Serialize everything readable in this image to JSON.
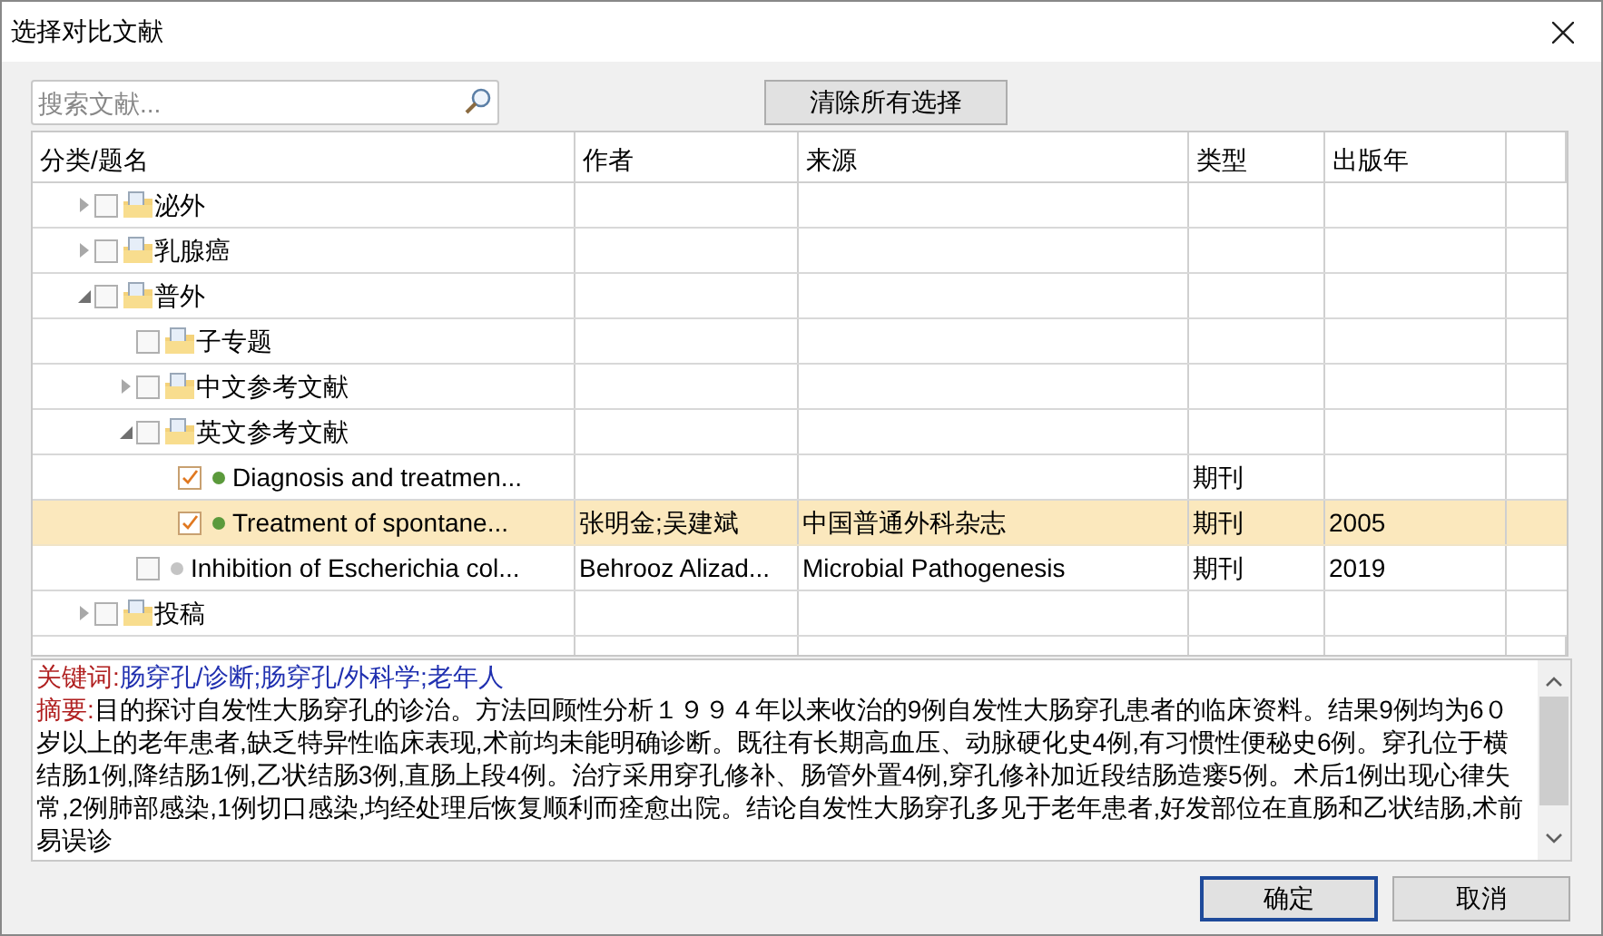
{
  "window": {
    "title": "选择对比文献"
  },
  "search": {
    "placeholder": "搜索文献..."
  },
  "clear_button": "清除所有选择",
  "table": {
    "columns": [
      "分类/题名",
      "作者",
      "来源",
      "类型",
      "出版年"
    ],
    "rows": [
      {
        "kind": "folder",
        "title": "泌外",
        "checked": false,
        "expanded": false
      },
      {
        "kind": "folder",
        "title": "乳腺癌",
        "checked": false,
        "expanded": false
      },
      {
        "kind": "folder",
        "title": "普外",
        "checked": false,
        "expanded": true,
        "children": [
          {
            "kind": "folder",
            "title": "子专题",
            "checked": false
          },
          {
            "kind": "folder",
            "title": "中文参考文献",
            "checked": false,
            "expanded": false
          },
          {
            "kind": "folder",
            "title": "英文参考文献",
            "checked": false,
            "expanded": true,
            "children": [
              {
                "kind": "document",
                "title": "Diagnosis and treatmen...",
                "checked": true,
                "selected": false,
                "color": "#5b9a3c",
                "type": "期刊"
              },
              {
                "kind": "document",
                "title": "Treatment of spontane...",
                "checked": true,
                "selected": true,
                "color": "#5b9a3c",
                "author": "张明金;吴建斌",
                "source": "中国普通外科杂志",
                "type": "期刊",
                "year": "2005"
              }
            ]
          },
          {
            "kind": "document",
            "title": "Inhibition of Escherichia col...",
            "checked": false,
            "selected": false,
            "color": "#c4c4c4",
            "author": "Behrooz Alizad...",
            "source": "Microbial Pathogenesis",
            "type": "期刊",
            "year": "2019"
          }
        ]
      },
      {
        "kind": "folder",
        "title": "投稿",
        "checked": false,
        "expanded": false
      }
    ]
  },
  "details": {
    "keywords_label": "关键词:",
    "keywords": "肠穿孔/诊断;肠穿孔/外科学;老年人",
    "abstract_label": "摘要:",
    "abstract": "目的探讨自发性大肠穿孔的诊治。方法回顾性分析１９９４年以来收治的9例自发性大肠穿孔患者的临床资料。结果9例均为6０岁以上的老年患者,缺乏特异性临床表现,术前均未能明确诊断。既往有长期高血压、动脉硬化史4例,有习惯性便秘史6例。穿孔位于横结肠1例,降结肠1例,乙状结肠3例,直肠上段4例。治疗采用穿孔修补、肠管外置4例,穿孔修补加近段结肠造瘘5例。术后1例出现心律失常,2例肺部感染,1例切口感染,均经处理后恢复顺利而痊愈出院。结论自发性大肠穿孔多见于老年患者,好发部位在直肠和乙状结肠,术前易误诊"
  },
  "buttons": [
    {
      "label": "确定",
      "focused": true
    },
    {
      "label": "取消",
      "focused": false
    }
  ]
}
